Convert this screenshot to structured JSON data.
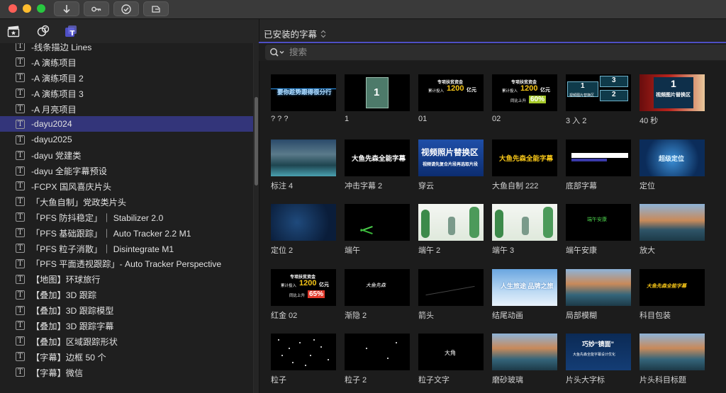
{
  "browser": {
    "title": "已安装的字幕",
    "search_placeholder": "搜索"
  },
  "sidebar": {
    "items": [
      {
        "label": "-线条描边 Lines",
        "selected": false
      },
      {
        "label": "-A 演练项目",
        "selected": false
      },
      {
        "label": "-A 演练项目 2",
        "selected": false
      },
      {
        "label": "-A 演练项目 3",
        "selected": false
      },
      {
        "label": "-A 月亮项目",
        "selected": false
      },
      {
        "label": "-dayu2024",
        "selected": true
      },
      {
        "label": "-dayu2025",
        "selected": false
      },
      {
        "label": "-dayu 党建类",
        "selected": false
      },
      {
        "label": "-dayu 全能字幕预设",
        "selected": false
      },
      {
        "label": "-FCPX 国风喜庆片头",
        "selected": false
      },
      {
        "label": "「大鱼自制」党政类片头",
        "selected": false
      },
      {
        "label": "「PFS 防抖稳定」｜ Stabilizer 2.0",
        "selected": false
      },
      {
        "label": "「PFS 基础跟踪」｜ Auto Tracker 2.2 M1",
        "selected": false
      },
      {
        "label": "「PFS 粒子消散」｜ Disintegrate M1",
        "selected": false
      },
      {
        "label": "「PFS 平面透视跟踪」- Auto Tracker Perspective",
        "selected": false
      },
      {
        "label": "【地图】环球旅行",
        "selected": false
      },
      {
        "label": "【叠加】3D 跟踪",
        "selected": false
      },
      {
        "label": "【叠加】3D 跟踪模型",
        "selected": false
      },
      {
        "label": "【叠加】3D 跟踪字幕",
        "selected": false
      },
      {
        "label": "【叠加】区域跟踪形状",
        "selected": false
      },
      {
        "label": "【字幕】边框 50 个",
        "selected": false
      },
      {
        "label": "【字幕】微信",
        "selected": false
      }
    ]
  },
  "thumb_text": {
    "t0": "要你趁势跟得很分行",
    "t1": "1",
    "t2_line1": "专项扶贫资金",
    "t2_line2": "累计投入",
    "t2_value": "1200",
    "t2_unit": "亿元",
    "t3_line1": "专项扶贫资金",
    "t3_line2": "累计投入",
    "t3_value": "1200",
    "t3_unit": "亿元",
    "t3_line3": "同比上升",
    "t3_pct": "60%",
    "t4_a": "1",
    "t4_b": "3",
    "t4_c": "2",
    "t4_sub": "视频图片替换区",
    "t5_num": "1",
    "t5_sub": "视频图片替换区",
    "t7": "大鱼先森全能字幕",
    "t8_main": "视频照片替换区",
    "t8_sub": "视频请先复合片段再选取片段",
    "t9": "大鱼先森全能字幕",
    "t11": "超级定位",
    "t17": "端午安康",
    "t19_line1": "专项扶贫资金",
    "t19_line2": "累计投入",
    "t19_value": "1200",
    "t19_unit": "亿元",
    "t19_line3": "同比上升",
    "t19_pct": "65%",
    "t20": "大鱼先森",
    "t22": "人生旅途 品牌之旅",
    "t24": "大鱼先森全能字幕",
    "t27": "大角",
    "t29_main": "巧妙“镜面”",
    "t29_sub": "大鱼先森全能字幕设计优化"
  },
  "tiles": [
    {
      "label": "? ? ?"
    },
    {
      "label": "1"
    },
    {
      "label": "01"
    },
    {
      "label": "02"
    },
    {
      "label": "3 入 2"
    },
    {
      "label": "40 秒"
    },
    {
      "label": "标注 4"
    },
    {
      "label": "冲击字幕 2"
    },
    {
      "label": "穿云"
    },
    {
      "label": "大鱼自制 222"
    },
    {
      "label": "底部字幕"
    },
    {
      "label": "定位"
    },
    {
      "label": "定位 2"
    },
    {
      "label": "端午"
    },
    {
      "label": "端午 2"
    },
    {
      "label": "端午 3"
    },
    {
      "label": "端午安康"
    },
    {
      "label": "放大"
    },
    {
      "label": "红金 02"
    },
    {
      "label": "渐隐 2"
    },
    {
      "label": "箭头"
    },
    {
      "label": "结尾动画"
    },
    {
      "label": "局部模糊"
    },
    {
      "label": "科目包装"
    },
    {
      "label": "粒子"
    },
    {
      "label": "粒子 2"
    },
    {
      "label": "粒子文字"
    },
    {
      "label": "磨砂玻璃"
    },
    {
      "label": "片头大字标"
    },
    {
      "label": "片头科目标题"
    }
  ],
  "colors": {
    "accent": "#4e4fc4",
    "selection": "#33357a",
    "gold": "#f5c518",
    "red": "#e23a2c"
  }
}
